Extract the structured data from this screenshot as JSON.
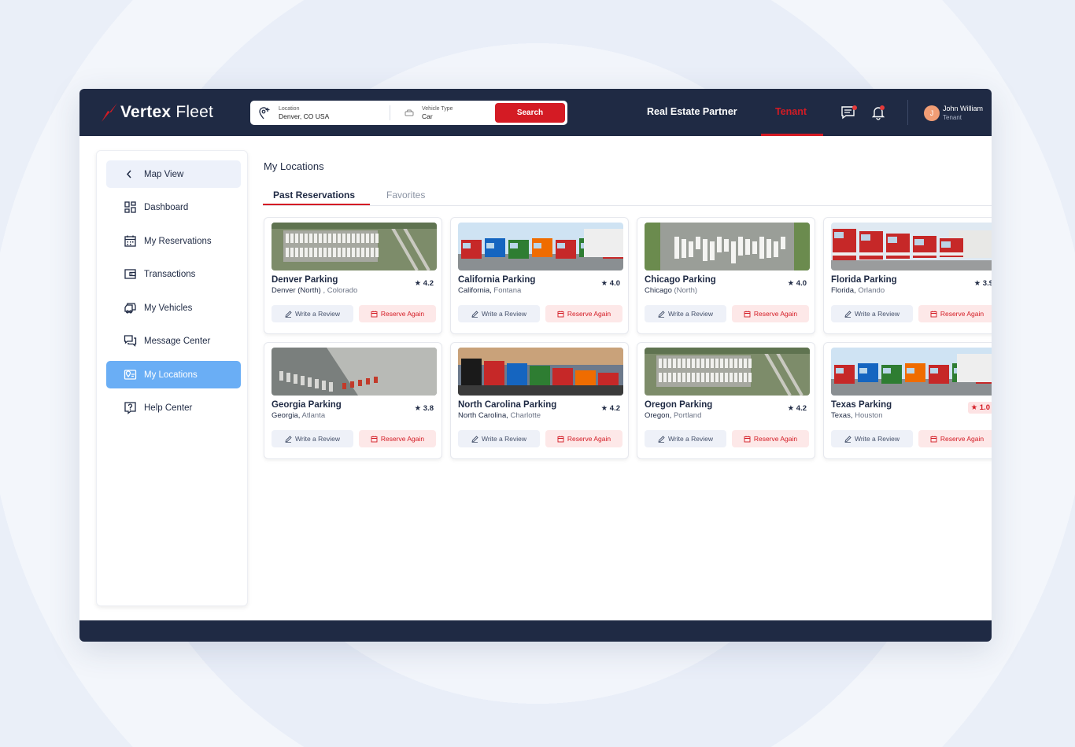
{
  "brand": {
    "name_bold": "Vertex",
    "name_light": "Fleet",
    "accent": "#d41b24",
    "navy": "#1f2a44"
  },
  "search": {
    "location_label": "Location",
    "location_value": "Denver, CO USA",
    "vehicle_label": "Vehicle Type",
    "vehicle_value": "Car",
    "button": "Search"
  },
  "nav": {
    "real_estate": "Real Estate Partner",
    "tenant": "Tenant"
  },
  "user": {
    "initial": "J",
    "name": "John William",
    "role": "Tenant"
  },
  "sidebar": {
    "items": [
      {
        "label": "Map View",
        "icon": "chevron-left-icon"
      },
      {
        "label": "Dashboard",
        "icon": "dashboard-icon"
      },
      {
        "label": "My Reservations",
        "icon": "calendar-icon"
      },
      {
        "label": "Transactions",
        "icon": "wallet-icon"
      },
      {
        "label": "My Vehicles",
        "icon": "vehicles-icon"
      },
      {
        "label": "Message Center",
        "icon": "chat-icon"
      },
      {
        "label": "My Locations",
        "icon": "locations-icon"
      },
      {
        "label": "Help Center",
        "icon": "help-icon"
      }
    ],
    "active": "My Locations"
  },
  "main": {
    "title": "My Locations",
    "tabs": [
      {
        "label": "Past Reservations"
      },
      {
        "label": "Favorites"
      }
    ],
    "active_tab": "Past Reservations",
    "review_label": "Write a Review",
    "reserve_label": "Reserve Again",
    "cards": [
      {
        "name": "Denver Parking",
        "loc_main": "Denver (North)",
        "loc_sub": " , Colorado",
        "rating": "4.2",
        "image": "aerial-lot"
      },
      {
        "name": "California Parking",
        "loc_main": "California,",
        "loc_sub": " Fontana",
        "rating": "4.0",
        "image": "trucks-row"
      },
      {
        "name": "Chicago Parking",
        "loc_main": "Chicago",
        "loc_sub": " (North)",
        "rating": "4.0",
        "image": "aerial-trailers"
      },
      {
        "name": "Florida Parking",
        "loc_main": "Florida,",
        "loc_sub": " Orlando",
        "rating": "3.9",
        "image": "red-trucks"
      },
      {
        "name": "Georgia Parking",
        "loc_main": "Georgia,",
        "loc_sub": " Atlanta",
        "rating": "3.8",
        "image": "warehouse"
      },
      {
        "name": "North Carolina Parking",
        "loc_main": "North Carolina,",
        "loc_sub": " Charlotte",
        "rating": "4.2",
        "image": "sunset-trucks"
      },
      {
        "name": "Oregon Parking",
        "loc_main": "Oregon,",
        "loc_sub": " Portland",
        "rating": "4.2",
        "image": "aerial-lot"
      },
      {
        "name": "Texas Parking",
        "loc_main": "Texas,",
        "loc_sub": " Houston",
        "rating": "1.0",
        "image": "trucks-row",
        "low": true
      }
    ]
  }
}
